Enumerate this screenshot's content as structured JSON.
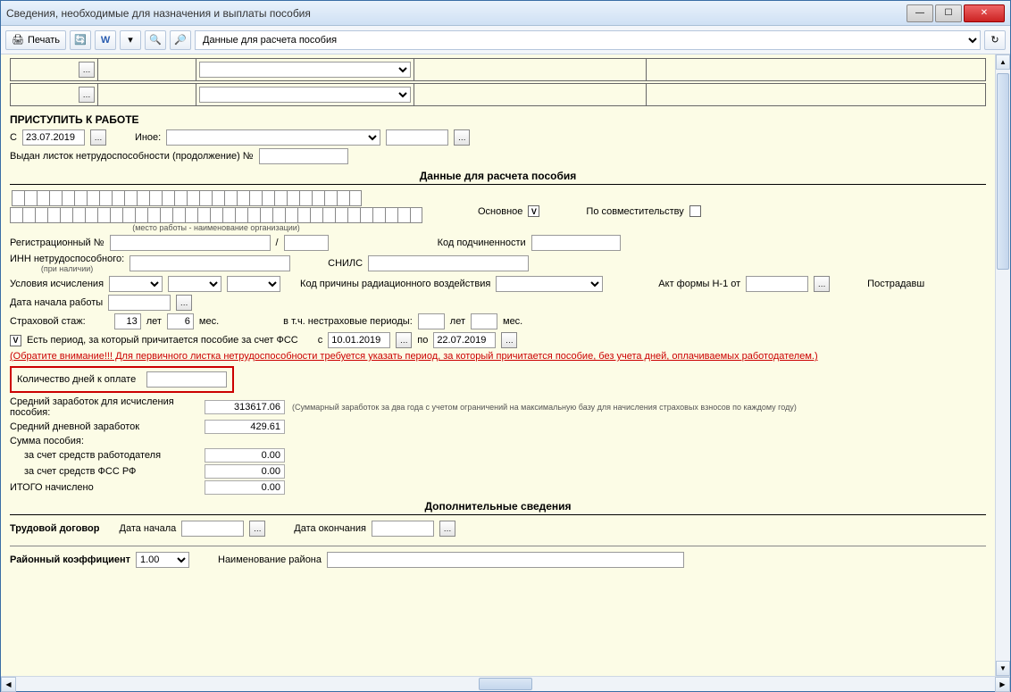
{
  "window": {
    "title": "Сведения, необходимые для назначения и выплаты пособия"
  },
  "toolbar": {
    "print": "Печать",
    "dropdown_selected": "Данные для расчета пособия"
  },
  "sections": {
    "start_work": "ПРИСТУПИТЬ К РАБОТЕ",
    "calc_data": "Данные для расчета пособия",
    "additional": "Дополнительные сведения"
  },
  "labels": {
    "from": "С",
    "other": "Иное:",
    "sheet_issued": "Выдан листок нетрудоспособности (продолжение) №",
    "workplace_note": "(место работы - наименование организации)",
    "main": "Основное",
    "part_time": "По совместительству",
    "reg_no": "Регистрационный №",
    "sub_code": "Код подчиненности",
    "inn": "ИНН нетрудоспособного:",
    "inn_note": "(при наличии)",
    "snils": "СНИЛС",
    "calc_conditions": "Условия исчисления",
    "radiation_code": "Код причины радиационного воздействия",
    "act_n1": "Акт формы Н-1 от",
    "victim": "Пострадавш",
    "work_start_date": "Дата начала работы",
    "insurance_period": "Страховой стаж:",
    "years": "лет",
    "months": "мес.",
    "non_insurance": "в т.ч. нестраховые периоды:",
    "has_fss_period": "Есть период, за который причитается пособие за счет ФСС",
    "from_c": "с",
    "to": "по",
    "warning": "(Обратите внимание!!! Для первичного листка нетрудоспособности требуется указать период, за который причитается пособие, без учета дней, оплачиваемых работодателем.)",
    "days_to_pay": "Количество дней к оплате",
    "avg_earnings": "Средний заработок для исчисления пособия:",
    "avg_earnings_note": "(Суммарный заработок за два года с учетом ограничений на максимальную базу для начисления страховых взносов по каждому году)",
    "avg_daily": "Средний дневной заработок",
    "benefit_sum": "Сумма пособия:",
    "employer_funds": "за счет средств работодателя",
    "fss_funds": "за счет средств ФСС РФ",
    "total": "ИТОГО начислено",
    "contract": "Трудовой договор",
    "start_date_lbl": "Дата начала",
    "end_date_lbl": "Дата окончания",
    "region_coef": "Районный коэффициент",
    "region_name": "Наименование района"
  },
  "values": {
    "start_date": "23.07.2019",
    "ins_years": "13",
    "ins_months": "6",
    "fss_from": "10.01.2019",
    "fss_to": "22.07.2019",
    "avg_earnings": "313617.06",
    "avg_daily": "429.61",
    "employer_sum": "0.00",
    "fss_sum": "0.00",
    "total_sum": "0.00",
    "region_coef": "1.00"
  }
}
